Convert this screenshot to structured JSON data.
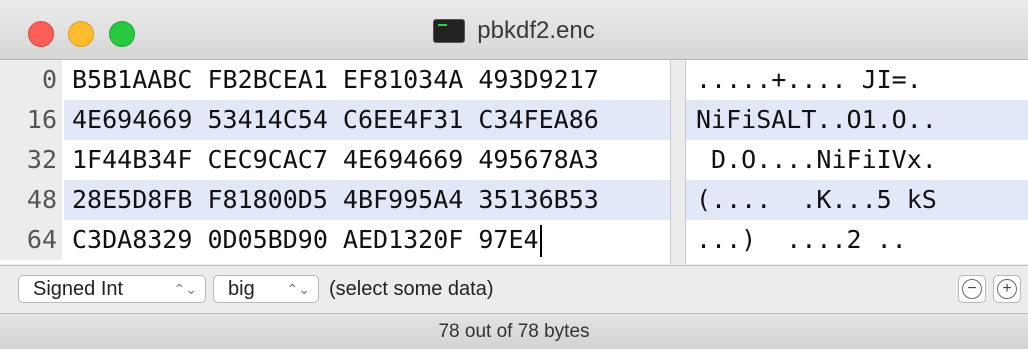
{
  "window": {
    "title": "pbkdf2.enc",
    "file_icon": "terminal-document-icon"
  },
  "hex_view": {
    "rows": [
      {
        "offset": "0",
        "hex": "B5B1AABC FB2BCEA1 EF81034A 493D9217",
        "ascii": ".....+.... JI=."
      },
      {
        "offset": "16",
        "hex": "4E694669 53414C54 C6EE4F31 C34FEA86",
        "ascii": "NiFiSALT..O1.O.."
      },
      {
        "offset": "32",
        "hex": "1F44B34F CEC9CAC7 4E694669 495678A3",
        "ascii": " D.O....NiFiIVx."
      },
      {
        "offset": "48",
        "hex": "28E5D8FB F81800D5 4BF995A4 35136B53",
        "ascii": "(....  .K...5 kS"
      },
      {
        "offset": "64",
        "hex": "C3DA8329 0D05BD90 AED1320F 97E4",
        "ascii": "...)  ....2 .."
      }
    ]
  },
  "controls": {
    "type_select": "Signed Int",
    "endian_select": "big",
    "selection_hint": "(select some data)",
    "minus_button": "−",
    "plus_button": "+"
  },
  "status": {
    "text": "78 out of 78 bytes"
  },
  "colors": {
    "alt_row": "#e3e8f8",
    "close": "#fc5f57",
    "minimize": "#fdbc2e",
    "maximize": "#28c840"
  }
}
